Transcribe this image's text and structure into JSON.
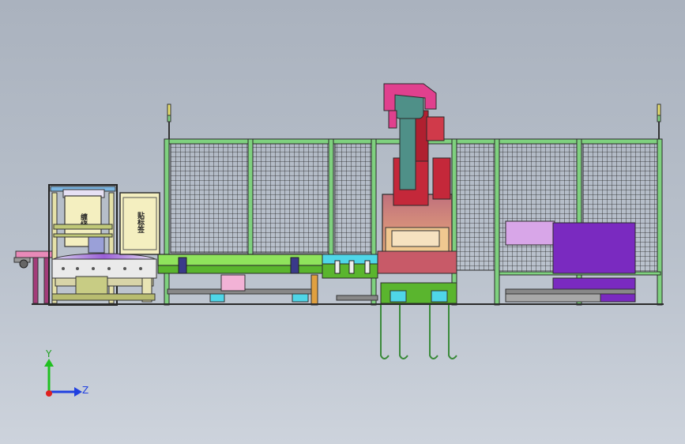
{
  "colors": {
    "frame": "#2a2a2a",
    "fence_top": "#7fd17f",
    "conveyor": "#8fe35c",
    "conveyor_dark": "#5ab52e",
    "cyan": "#4fd6e8",
    "robot_magenta": "#e0408e",
    "robot_red": "#c4283a",
    "robot_teal": "#4f9088",
    "purple": "#7a2ac0",
    "lilac": "#d8a6e8",
    "cream": "#f4efc0",
    "pink": "#f2b2d6",
    "axis_x": "#e02020",
    "axis_y": "#20c020",
    "axis_z": "#2040e0"
  },
  "labels": {
    "label_left_box": "缠绕",
    "label_right_box": "贴标签"
  },
  "axes": {
    "y": "Y",
    "z": "Z"
  }
}
